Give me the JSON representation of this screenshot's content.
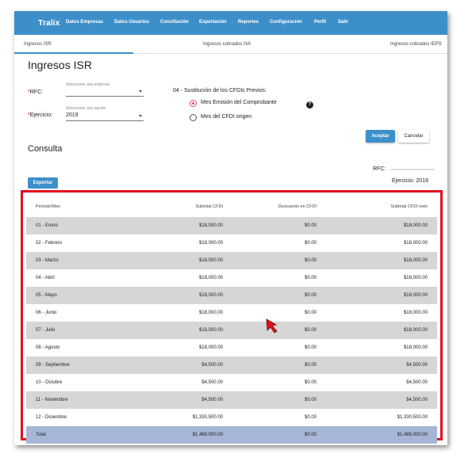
{
  "nav": {
    "brand": "Tralix",
    "items": [
      "Datos Empresas",
      "Datos Usuarios",
      "Conciliación",
      "Exportación",
      "Reportes",
      "Configuración",
      "Perfil",
      "Salir"
    ]
  },
  "tabs": [
    "Ingresos ISR",
    "Ingresos cobrados IVA",
    "Ingresos cobrados IEPS"
  ],
  "page": {
    "title": "Ingresos ISR"
  },
  "form": {
    "rfc": {
      "label": "RFC:",
      "helper": "Seleccione una empresa",
      "value": ""
    },
    "ejercicio": {
      "label": "Ejercicio:",
      "helper": "Seleccione una opción",
      "value": "2019"
    },
    "sustitucion": {
      "label": "04 - Sustitución de los CFDIs Previos:",
      "options": [
        "Mes Emisión del Comprobante",
        "Mes del CFDI origen"
      ],
      "selected": 0
    },
    "help_icon": "question-circle-icon",
    "accept_label": "Aceptar",
    "cancel_label": "Cancelar"
  },
  "consulta": {
    "title": "Consulta",
    "rfc_label": "RFC:",
    "ejercicio_text": "Ejercicio: 2019",
    "export_label": "Exportar"
  },
  "table": {
    "headers": [
      "Periodo/Mes",
      "Subtotal CFDI",
      "Descuento en CFDI",
      "Subtotal CFDI neto"
    ],
    "rows": [
      [
        "01 - Enero",
        "$18,000.00",
        "$0.00",
        "$18,000.00"
      ],
      [
        "02 - Febrero",
        "$18,000.00",
        "$0.00",
        "$18,000.00"
      ],
      [
        "03 - Marzo",
        "$18,000.00",
        "$0.00",
        "$18,000.00"
      ],
      [
        "04 - Abril",
        "$18,000.00",
        "$0.00",
        "$18,000.00"
      ],
      [
        "05 - Mayo",
        "$18,000.00",
        "$0.00",
        "$18,000.00"
      ],
      [
        "06 - Junio",
        "$18,000.00",
        "$0.00",
        "$18,000.00"
      ],
      [
        "07 - Julio",
        "$18,000.00",
        "$0.00",
        "$18,000.00"
      ],
      [
        "08 - Agosto",
        "$18,000.00",
        "$0.00",
        "$18,000.00"
      ],
      [
        "09 - Septiembre",
        "$4,500.00",
        "$0.00",
        "$4,500.00"
      ],
      [
        "10 - Octubre",
        "$4,500.00",
        "$0.00",
        "$4,500.00"
      ],
      [
        "11 - Noviembre",
        "$4,500.00",
        "$0.00",
        "$4,500.00"
      ],
      [
        "12 - Diciembre",
        "$1,330,500.00",
        "$0.00",
        "$1,330,500.00"
      ]
    ],
    "total": [
      "Total",
      "$1,488,000.00",
      "$0.00",
      "$1,488,000.00"
    ]
  },
  "colors": {
    "primary": "#3d8fc9",
    "highlight_border": "#e3101e",
    "row_shade": "#d6d6d6",
    "total_row": "#a5b6d6",
    "radio_selected": "#e1485c"
  }
}
